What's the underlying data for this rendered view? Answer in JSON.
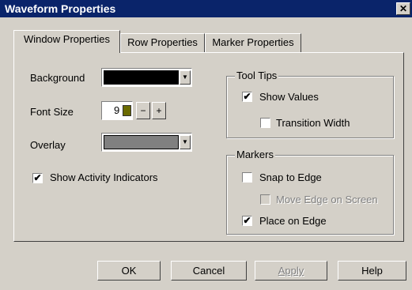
{
  "window": {
    "title": "Waveform Properties",
    "close_glyph": "✕"
  },
  "tabs": [
    {
      "label": "Window Properties",
      "active": true
    },
    {
      "label": "Row Properties",
      "active": false
    },
    {
      "label": "Marker Properties",
      "active": false
    }
  ],
  "window_props": {
    "background_label": "Background",
    "background_color": "#000000",
    "font_size_label": "Font Size",
    "font_size_value": "9",
    "minus": "−",
    "plus": "+",
    "overlay_label": "Overlay",
    "overlay_color": "#808080",
    "show_activity_label": "Show Activity Indicators",
    "show_activity_checked": true
  },
  "tooltips_group": {
    "title": "Tool Tips",
    "show_values_label": "Show Values",
    "show_values_checked": true,
    "transition_width_label": "Transition Width",
    "transition_width_checked": false
  },
  "markers_group": {
    "title": "Markers",
    "snap_label": "Snap to Edge",
    "snap_checked": false,
    "move_label": "Move Edge on Screen",
    "move_checked": false,
    "move_disabled": true,
    "place_label": "Place on Edge",
    "place_checked": true
  },
  "buttons": {
    "ok": "OK",
    "cancel": "Cancel",
    "apply": "Apply",
    "help": "Help"
  },
  "check_glyph": "✔"
}
